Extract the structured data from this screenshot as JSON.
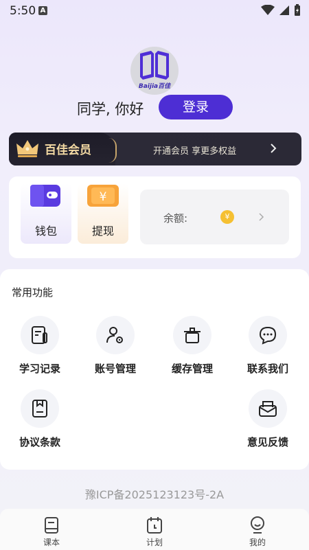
{
  "status_bar": {
    "time": "5:50",
    "notification_glyph": "A"
  },
  "profile": {
    "greeting": "同学, 你好",
    "login_label": "登录",
    "logo_text": "Baijia百佳"
  },
  "vip": {
    "title": "百佳会员",
    "subtitle": "开通会员 享更多权益",
    "accent_color": "#f3d9a3"
  },
  "wallet": {
    "tiles": [
      {
        "label": "钱包"
      },
      {
        "label": "提现"
      }
    ],
    "balance_label": "余额:",
    "coin_glyph": "¥"
  },
  "functions": {
    "title": "常用功能",
    "items": [
      {
        "label": "学习记录",
        "icon": "study-record-icon"
      },
      {
        "label": "账号管理",
        "icon": "account-settings-icon"
      },
      {
        "label": "缓存管理",
        "icon": "cache-trash-icon"
      },
      {
        "label": "联系我们",
        "icon": "chat-bubble-icon"
      },
      {
        "label": "协议条款",
        "icon": "document-icon"
      },
      {
        "label": "意见反馈",
        "icon": "mail-icon"
      }
    ]
  },
  "footer": {
    "icp": "豫ICP备2025123123号-2A"
  },
  "bottom_nav": {
    "items": [
      {
        "label": "课本",
        "icon": "book-icon"
      },
      {
        "label": "计划",
        "icon": "calendar-icon"
      },
      {
        "label": "我的",
        "icon": "profile-icon"
      }
    ]
  },
  "colors": {
    "primary": "#4d2ed4",
    "vip_bg": "#2c2a38"
  }
}
